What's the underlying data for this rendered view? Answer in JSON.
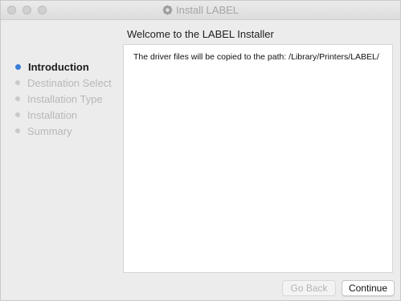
{
  "window": {
    "title": "Install LABEL",
    "title_icon": "installer-gear-icon"
  },
  "header": {
    "welcome": "Welcome to the LABEL Installer"
  },
  "sidebar": {
    "items": [
      {
        "label": "Introduction",
        "state": "active"
      },
      {
        "label": "Destination Select",
        "state": "inactive"
      },
      {
        "label": "Installation Type",
        "state": "inactive"
      },
      {
        "label": "Installation",
        "state": "inactive"
      },
      {
        "label": "Summary",
        "state": "inactive"
      }
    ]
  },
  "content": {
    "message": "The driver files will be copied to the path: /Library/Printers/LABEL/"
  },
  "buttons": {
    "back_label": "Go Back",
    "continue_label": "Continue"
  },
  "colors": {
    "active_step": "#3a7ed8",
    "inactive_step": "#c9c9c9"
  }
}
